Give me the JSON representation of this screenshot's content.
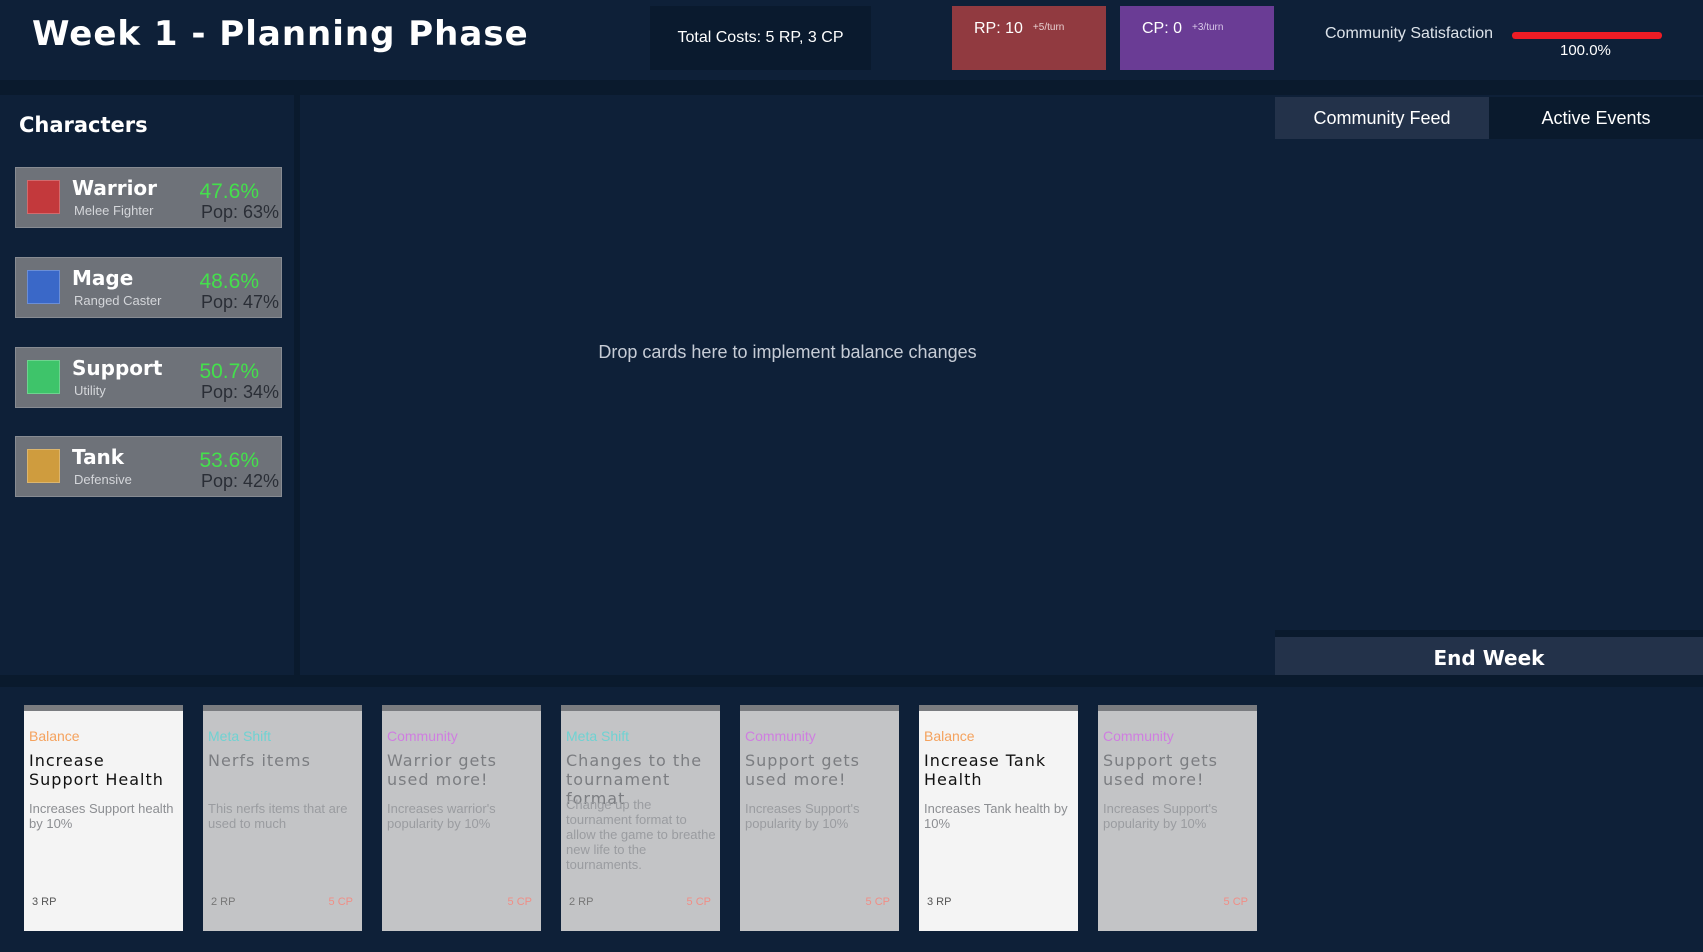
{
  "header": {
    "title": "Week 1 - Planning Phase",
    "total_costs": "Total Costs: 5 RP, 3 CP",
    "rp": {
      "value": "RP: 10",
      "rate": "+5/turn",
      "color": "#913a40"
    },
    "cp": {
      "value": "CP: 0",
      "rate": "+3/turn",
      "color": "#6a3c95"
    },
    "satisfaction": {
      "label": "Community Satisfaction",
      "value": "100.0%",
      "fraction": 1.0
    }
  },
  "characters": {
    "title": "Characters",
    "items": [
      {
        "name": "Warrior",
        "role": "Melee Fighter",
        "win": "47.6%",
        "pop": "Pop: 63%",
        "color": "#c3393c"
      },
      {
        "name": "Mage",
        "role": "Ranged Caster",
        "win": "48.6%",
        "pop": "Pop: 47%",
        "color": "#3a68c8"
      },
      {
        "name": "Support",
        "role": "Utility",
        "win": "50.7%",
        "pop": "Pop: 34%",
        "color": "#3ec46a"
      },
      {
        "name": "Tank",
        "role": "Defensive",
        "win": "53.6%",
        "pop": "Pop: 42%",
        "color": "#cf9c3e"
      }
    ]
  },
  "drop_zone": {
    "text": "Drop cards here to implement balance changes"
  },
  "right_panel": {
    "tabs": [
      {
        "label": "Community Feed"
      },
      {
        "label": "Active Events"
      }
    ],
    "end_week_label": "End Week"
  },
  "type_colors": {
    "Balance": "#f5a25d",
    "Meta Shift": "#6fd2d2",
    "Community": "#cf7ee0"
  },
  "hand": [
    {
      "type": "Balance",
      "title": "Increase Support Health",
      "desc": "Increases Support health by 10%",
      "rp": "3 RP",
      "cp": "",
      "playable": true
    },
    {
      "type": "Meta Shift",
      "title": "Nerfs items",
      "desc": "This nerfs items that are used to much",
      "rp": "2 RP",
      "cp": "5 CP",
      "playable": false
    },
    {
      "type": "Community",
      "title": "Warrior gets used more!",
      "desc": "Increases warrior's popularity by 10%",
      "rp": "",
      "cp": "5 CP",
      "playable": false
    },
    {
      "type": "Meta Shift",
      "title": "Changes to the tournament format",
      "desc": "Change up the tournament format to allow the game to breathe new life to the tournaments.",
      "rp": "2 RP",
      "cp": "5 CP",
      "playable": false
    },
    {
      "type": "Community",
      "title": "Support gets used more!",
      "desc": "Increases Support's popularity by 10%",
      "rp": "",
      "cp": "5 CP",
      "playable": false
    },
    {
      "type": "Balance",
      "title": "Increase Tank Health",
      "desc": "Increases Tank health by 10%",
      "rp": "3 RP",
      "cp": "",
      "playable": true
    },
    {
      "type": "Community",
      "title": "Support gets used more!",
      "desc": "Increases Support's popularity by 10%",
      "rp": "",
      "cp": "5 CP",
      "playable": false
    }
  ]
}
